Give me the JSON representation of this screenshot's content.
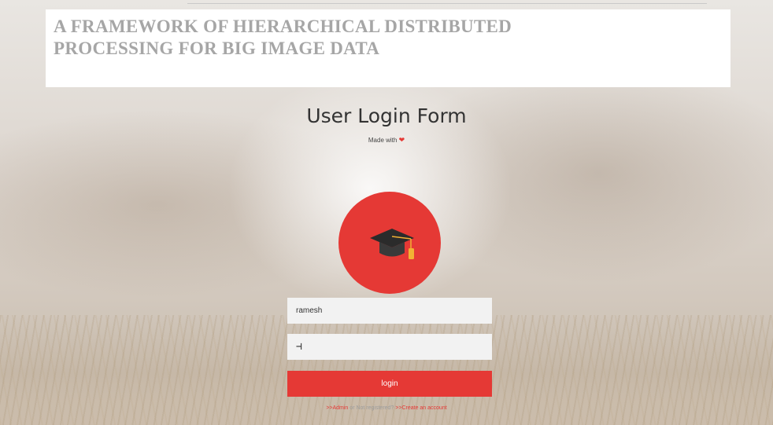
{
  "banner": {
    "title": "A FRAMEWORK OF HIERARCHICAL DISTRIBUTED\nPROCESSING FOR BIG IMAGE DATA"
  },
  "form": {
    "heading": "User Login Form",
    "made_with": "Made with",
    "logo_icon": "graduation-cap-icon",
    "username_value": "ramesh",
    "password_value": "⊣",
    "login_label": "login"
  },
  "footer": {
    "admin_link": ">>Admin",
    "separator_text": "or Not registered?",
    "create_link": ">>Create an account"
  },
  "colors": {
    "accent": "#e53935",
    "field_bg": "#f2f2f2",
    "heading": "#333333"
  }
}
